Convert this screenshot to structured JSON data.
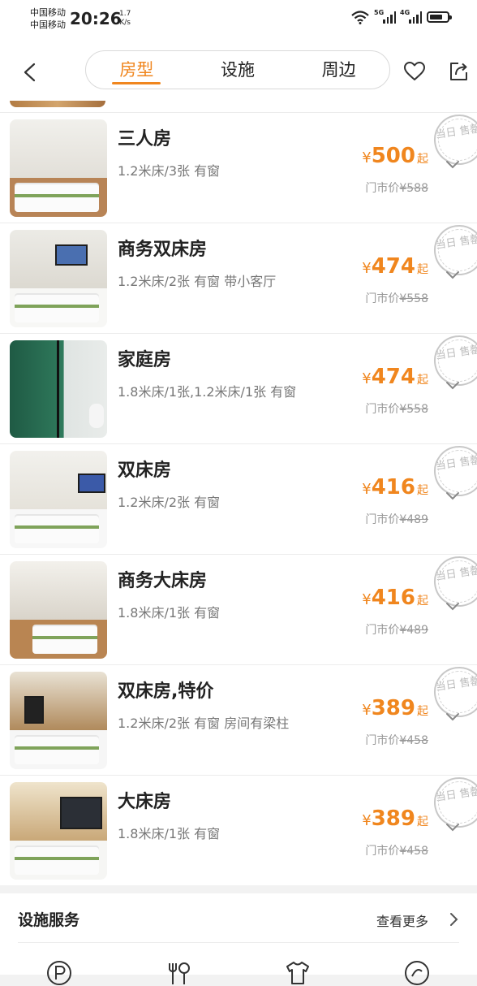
{
  "status_bar": {
    "carrier1": "中国移动",
    "carrier2": "中国移动",
    "time": "20:26",
    "speed_value": "1.7",
    "speed_unit": "K/s",
    "network1": "5G",
    "network2": "4G"
  },
  "nav": {
    "tabs": [
      "房型",
      "设施",
      "周边"
    ],
    "active_tab": 0
  },
  "colors": {
    "accent": "#f0861e",
    "muted": "#999999"
  },
  "rooms": [
    {
      "name": "三人房",
      "desc": "1.2米床/3张 有窗",
      "currency": "¥",
      "price": "500",
      "suffix": "起",
      "orig_label": "门市价",
      "orig_price": "¥588",
      "stamp": "当日 售罄"
    },
    {
      "name": "商务双床房",
      "desc": "1.2米床/2张 有窗 带小客厅",
      "currency": "¥",
      "price": "474",
      "suffix": "起",
      "orig_label": "门市价",
      "orig_price": "¥558",
      "stamp": "当日 售罄"
    },
    {
      "name": "家庭房",
      "desc": "1.8米床/1张,1.2米床/1张 有窗",
      "currency": "¥",
      "price": "474",
      "suffix": "起",
      "orig_label": "门市价",
      "orig_price": "¥558",
      "stamp": "当日 售罄"
    },
    {
      "name": "双床房",
      "desc": "1.2米床/2张 有窗",
      "currency": "¥",
      "price": "416",
      "suffix": "起",
      "orig_label": "门市价",
      "orig_price": "¥489",
      "stamp": "当日 售罄"
    },
    {
      "name": "商务大床房",
      "desc": "1.8米床/1张 有窗",
      "currency": "¥",
      "price": "416",
      "suffix": "起",
      "orig_label": "门市价",
      "orig_price": "¥489",
      "stamp": "当日 售罄"
    },
    {
      "name": "双床房,特价",
      "desc": "1.2米床/2张 有窗 房间有梁柱",
      "currency": "¥",
      "price": "389",
      "suffix": "起",
      "orig_label": "门市价",
      "orig_price": "¥458",
      "stamp": "当日 售罄"
    },
    {
      "name": "大床房",
      "desc": "1.8米床/1张 有窗",
      "currency": "¥",
      "price": "389",
      "suffix": "起",
      "orig_label": "门市价",
      "orig_price": "¥458",
      "stamp": "当日 售罄"
    }
  ],
  "facilities": {
    "title": "设施服务",
    "more": "查看更多",
    "icons": [
      "parking-icon",
      "dining-icon",
      "laundry-icon",
      "service-icon"
    ]
  }
}
